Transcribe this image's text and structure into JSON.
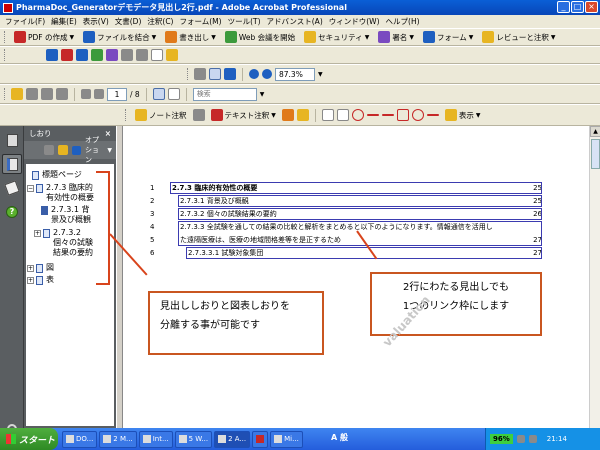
{
  "window": {
    "title": "PharmaDoc_Generatorデモデータ見出し2行.pdf - Adobe Acrobat Professional"
  },
  "menu": [
    "ファイル(F)",
    "編集(E)",
    "表示(V)",
    "文書(D)",
    "注釈(C)",
    "フォーム(M)",
    "ツール(T)",
    "アドバンスト(A)",
    "ウィンドウ(W)",
    "ヘルプ(H)"
  ],
  "toolbar1": {
    "create_pdf": "PDF の作成",
    "combine": "ファイルを結合",
    "export": "書き出し",
    "web_meeting": "Web 会議を開始",
    "security": "セキュリティ",
    "sign": "署名",
    "form": "フォーム",
    "review": "レビューと注釈"
  },
  "toolbar3": {
    "zoom": "87.3%"
  },
  "toolbar4": {
    "page_current": "1",
    "page_total": "/ 8",
    "search_placeholder": "検索"
  },
  "toolbar5": {
    "note_comment": "ノート注釈",
    "text_edit": "テキスト注釈",
    "display": "表示"
  },
  "bookmarks_panel": {
    "title": "しおり",
    "close": "×",
    "options": "オプション"
  },
  "bookmarks": [
    {
      "text": "標題ページ"
    },
    {
      "text": "2.7.3 臨床的 有効性の概要",
      "line1": "2.7.3  臨床的",
      "line2": "有効性の概要"
    },
    {
      "text": "2.7.3.1 背 景及び概観",
      "line1": "2.7.3.1 背",
      "line2": "景及び概観"
    },
    {
      "text": "2.7.3.2 個々の試験 結果の要約",
      "line1": "2.7.3.2",
      "line2": "個々の試験",
      "line3": "結果の要約"
    },
    {
      "text": "図"
    },
    {
      "text": "表"
    }
  ],
  "toc_rows": [
    {
      "num": "1",
      "text": "2.7.3  臨床的有効性の概要",
      "page": "25"
    },
    {
      "num": "2",
      "text": "2.7.3.1  背景及び概観",
      "page": "25"
    },
    {
      "num": "3",
      "text": "2.7.3.2  個々の試験結果の要約",
      "page": "26"
    },
    {
      "num": "4",
      "text": "2.7.3.3 全試験を通しての結果の比較と解析をまとめると以下のようになります。情報通信を活用し",
      "page": ""
    },
    {
      "num": "5",
      "text": "た遠隔医療は、医療の地域間格差等を是正するため",
      "page": "27"
    },
    {
      "num": "6",
      "text": "2.7.3.3.1  試験対象集団",
      "page": "27"
    }
  ],
  "callouts": {
    "left_line1": "見出ししおりと図表しおりを",
    "left_line2": "分離する事が可能です",
    "right_line1": "2行にわたる見出しでも",
    "right_line2": "1つのリンク枠にします"
  },
  "watermark": "valuation",
  "taskbar": {
    "start": "スタート",
    "tasks": [
      "DO...",
      "2 M...",
      "Int...",
      "5 W...",
      "2 A...",
      "",
      "Mi..."
    ],
    "ime": "A 般",
    "battery": "96%",
    "time": "21:14"
  },
  "colors": {
    "accent_orange": "#d8441c",
    "link_blue": "#3b3bb0",
    "nav_gray": "#5a5e61"
  }
}
